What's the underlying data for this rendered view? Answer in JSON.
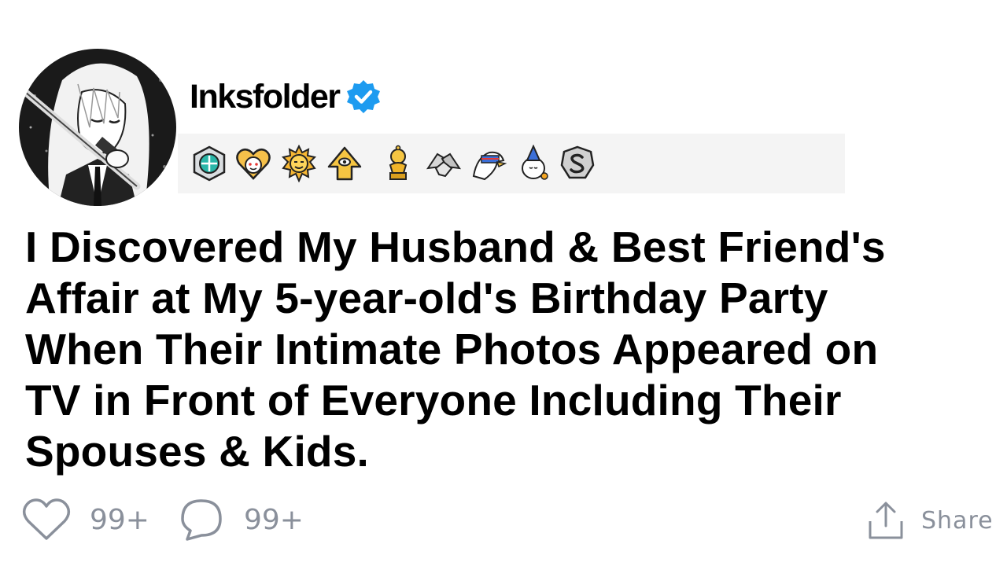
{
  "post": {
    "username": "Inksfolder",
    "verified_icon": "verified-badge-icon",
    "accent_color": "#1d9bf0",
    "awards": [
      "helpful-award-icon",
      "wholesome-heart-award-icon",
      "sun-award-icon",
      "all-seeing-upvote-award-icon",
      "gold-trophy-award-icon",
      "handshake-award-icon",
      "american-eagle-award-icon",
      "party-award-icon",
      "silver-s-award-icon"
    ],
    "title_lines": [
      "I Discovered My Husband & Best Friend's",
      "Affair at My 5-year-old's Birthday Party",
      "When Their Intimate Photos Appeared on",
      "TV in Front of Everyone Including Their",
      "Spouses & Kids."
    ]
  },
  "footer": {
    "likes_count": "99+",
    "comments_count": "99+",
    "share_label": "Share",
    "muted_color": "#8a909b"
  }
}
